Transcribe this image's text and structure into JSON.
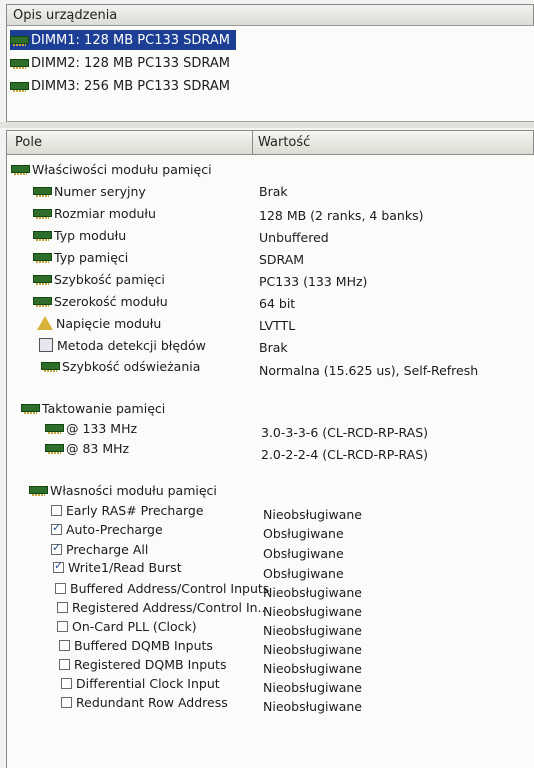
{
  "device_panel": {
    "title": "Opis urządzenia",
    "items": [
      {
        "label": "DIMM1: 128 MB PC133 SDRAM",
        "selected": true
      },
      {
        "label": "DIMM2: 128 MB PC133 SDRAM",
        "selected": false
      },
      {
        "label": "DIMM3: 256 MB PC133 SDRAM",
        "selected": false
      }
    ]
  },
  "table": {
    "col_field": "Pole",
    "col_value": "Wartość"
  },
  "groups": {
    "module_props": {
      "title": "Właściwości modułu pamięci",
      "rows": [
        {
          "field": "Numer seryjny",
          "value": "Brak",
          "icon": "memory-icon"
        },
        {
          "field": "Rozmiar modułu",
          "value": "128 MB (2 ranks, 4 banks)",
          "icon": "memory-icon"
        },
        {
          "field": "Typ modułu",
          "value": "Unbuffered",
          "icon": "memory-icon"
        },
        {
          "field": "Typ pamięci",
          "value": "SDRAM",
          "icon": "memory-icon"
        },
        {
          "field": "Szybkość pamięci",
          "value": "PC133 (133 MHz)",
          "icon": "memory-icon"
        },
        {
          "field": "Szerokość modułu",
          "value": "64 bit",
          "icon": "memory-icon"
        },
        {
          "field": "Napięcie modułu",
          "value": "LVTTL",
          "icon": "warning-icon"
        },
        {
          "field": "Metoda detekcji błędów",
          "value": "Brak",
          "icon": "detection-icon"
        },
        {
          "field": "Szybkość odświeżania",
          "value": "Normalna (15.625 us), Self-Refresh",
          "icon": "memory-icon"
        }
      ]
    },
    "timing": {
      "title": "Taktowanie pamięci",
      "rows": [
        {
          "field": "@ 133 MHz",
          "value": "3.0-3-3-6  (CL-RCD-RP-RAS)"
        },
        {
          "field": "@ 83 MHz",
          "value": "2.0-2-2-4  (CL-RCD-RP-RAS)"
        }
      ]
    },
    "features": {
      "title": "Własności modułu pamięci",
      "rows": [
        {
          "field": "Early RAS# Precharge",
          "value": "Nieobsługiwane",
          "checked": false
        },
        {
          "field": "Auto-Precharge",
          "value": "Obsługiwane",
          "checked": true
        },
        {
          "field": "Precharge All",
          "value": "Obsługiwane",
          "checked": true
        },
        {
          "field": "Write1/Read Burst",
          "value": "Obsługiwane",
          "checked": true
        },
        {
          "field": "Buffered Address/Control Inputs",
          "value": "Nieobsługiwane",
          "checked": false
        },
        {
          "field": "Registered Address/Control In...",
          "value": "Nieobsługiwane",
          "checked": false
        },
        {
          "field": "On-Card PLL (Clock)",
          "value": "Nieobsługiwane",
          "checked": false
        },
        {
          "field": "Buffered DQMB Inputs",
          "value": "Nieobsługiwane",
          "checked": false
        },
        {
          "field": "Registered DQMB Inputs",
          "value": "Nieobsługiwane",
          "checked": false
        },
        {
          "field": "Differential Clock Input",
          "value": "Nieobsługiwane",
          "checked": false
        },
        {
          "field": "Redundant Row Address",
          "value": "Nieobsługiwane",
          "checked": false
        }
      ]
    }
  },
  "colors": {
    "selection": "#1c3f95",
    "memory_icon": "#2f6e2a",
    "background": "#fbfbf9"
  }
}
